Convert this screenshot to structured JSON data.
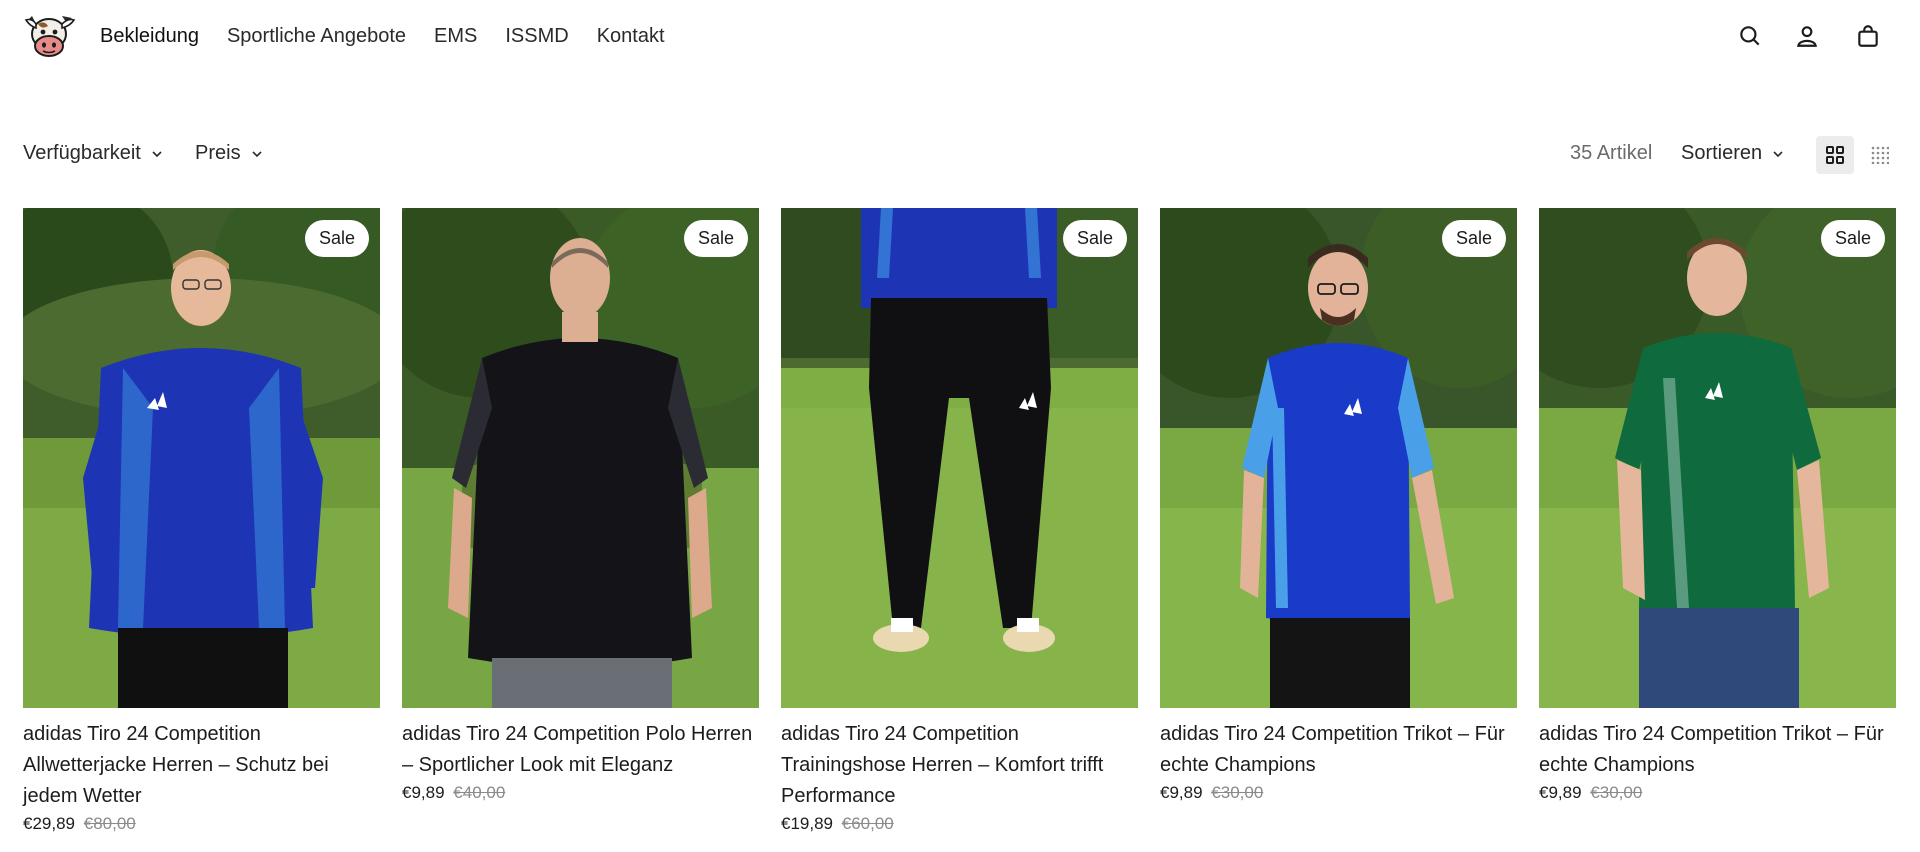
{
  "nav": {
    "items": [
      {
        "label": "Bekleidung"
      },
      {
        "label": "Sportliche Angebote"
      },
      {
        "label": "EMS"
      },
      {
        "label": "ISSMD"
      },
      {
        "label": "Kontakt"
      }
    ]
  },
  "header": {
    "icons": [
      "search-icon",
      "account-icon",
      "cart-icon"
    ]
  },
  "filters": {
    "availability": "Verfügbarkeit",
    "price": "Preis",
    "count": "35 Artikel",
    "sort": "Sortieren",
    "view_options": [
      "grid-large-icon",
      "grid-small-icon"
    ]
  },
  "products": [
    {
      "badge": "Sale",
      "title": "adidas Tiro 24 Competition Allwetterjacke Herren – Schutz bei jedem Wetter",
      "price": "€29,89",
      "old_price": "€80,00",
      "colors": {
        "shirt": "#1d35b4",
        "accent": "#3d8fe0",
        "pants": "#101010"
      }
    },
    {
      "badge": "Sale",
      "title": "adidas Tiro 24 Competition Polo Herren – Sportlicher Look mit Eleganz",
      "price": "€9,89",
      "old_price": "€40,00",
      "colors": {
        "shirt": "#141418",
        "accent": "#2b2b33",
        "pants": "#6a6e75"
      }
    },
    {
      "badge": "Sale",
      "title": "adidas Tiro 24 Competition Trainingshose Herren – Komfort trifft Performance",
      "price": "€19,89",
      "old_price": "€60,00",
      "colors": {
        "shirt": "#1d35b4",
        "accent": "#3d8fe0",
        "pants": "#101012"
      }
    },
    {
      "badge": "Sale",
      "title": "adidas Tiro 24 Competition Trikot – Für echte Champions",
      "price": "€9,89",
      "old_price": "€30,00",
      "colors": {
        "shirt": "#1a3ac8",
        "accent": "#4aa0e8",
        "pants": "#141414"
      }
    },
    {
      "badge": "Sale",
      "title": "adidas Tiro 24 Competition Trikot – Für echte Champions",
      "price": "€9,89",
      "old_price": "€30,00",
      "colors": {
        "shirt": "#0f6a3e",
        "accent": "#5a9a7e",
        "pants": "#2f4a7a"
      }
    }
  ]
}
